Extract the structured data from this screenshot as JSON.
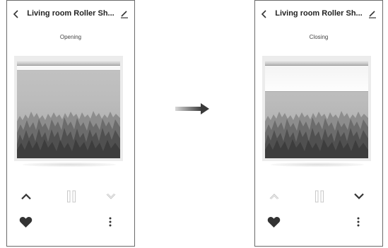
{
  "left_screen": {
    "title": "Living room Roller Sh...",
    "status": "Opening",
    "icons": {
      "back": "chevron-left-icon",
      "edit": "pencil-icon",
      "open": "chevron-up-icon",
      "pause": "pause-icon",
      "close": "chevron-down-icon",
      "favorite": "heart-icon",
      "more": "more-vertical-icon"
    },
    "active_control": "open"
  },
  "right_screen": {
    "title": "Living room Roller Sh...",
    "status": "Closing",
    "icons": {
      "back": "chevron-left-icon",
      "edit": "pencil-icon",
      "open": "chevron-up-icon",
      "pause": "pause-icon",
      "close": "chevron-down-icon",
      "favorite": "heart-icon",
      "more": "more-vertical-icon"
    },
    "active_control": "close"
  },
  "colors": {
    "active_icon": "#333333",
    "inactive_icon": "#c8c8c8",
    "arrow": "#444444"
  },
  "transition": {
    "icon": "right-arrow-icon"
  }
}
